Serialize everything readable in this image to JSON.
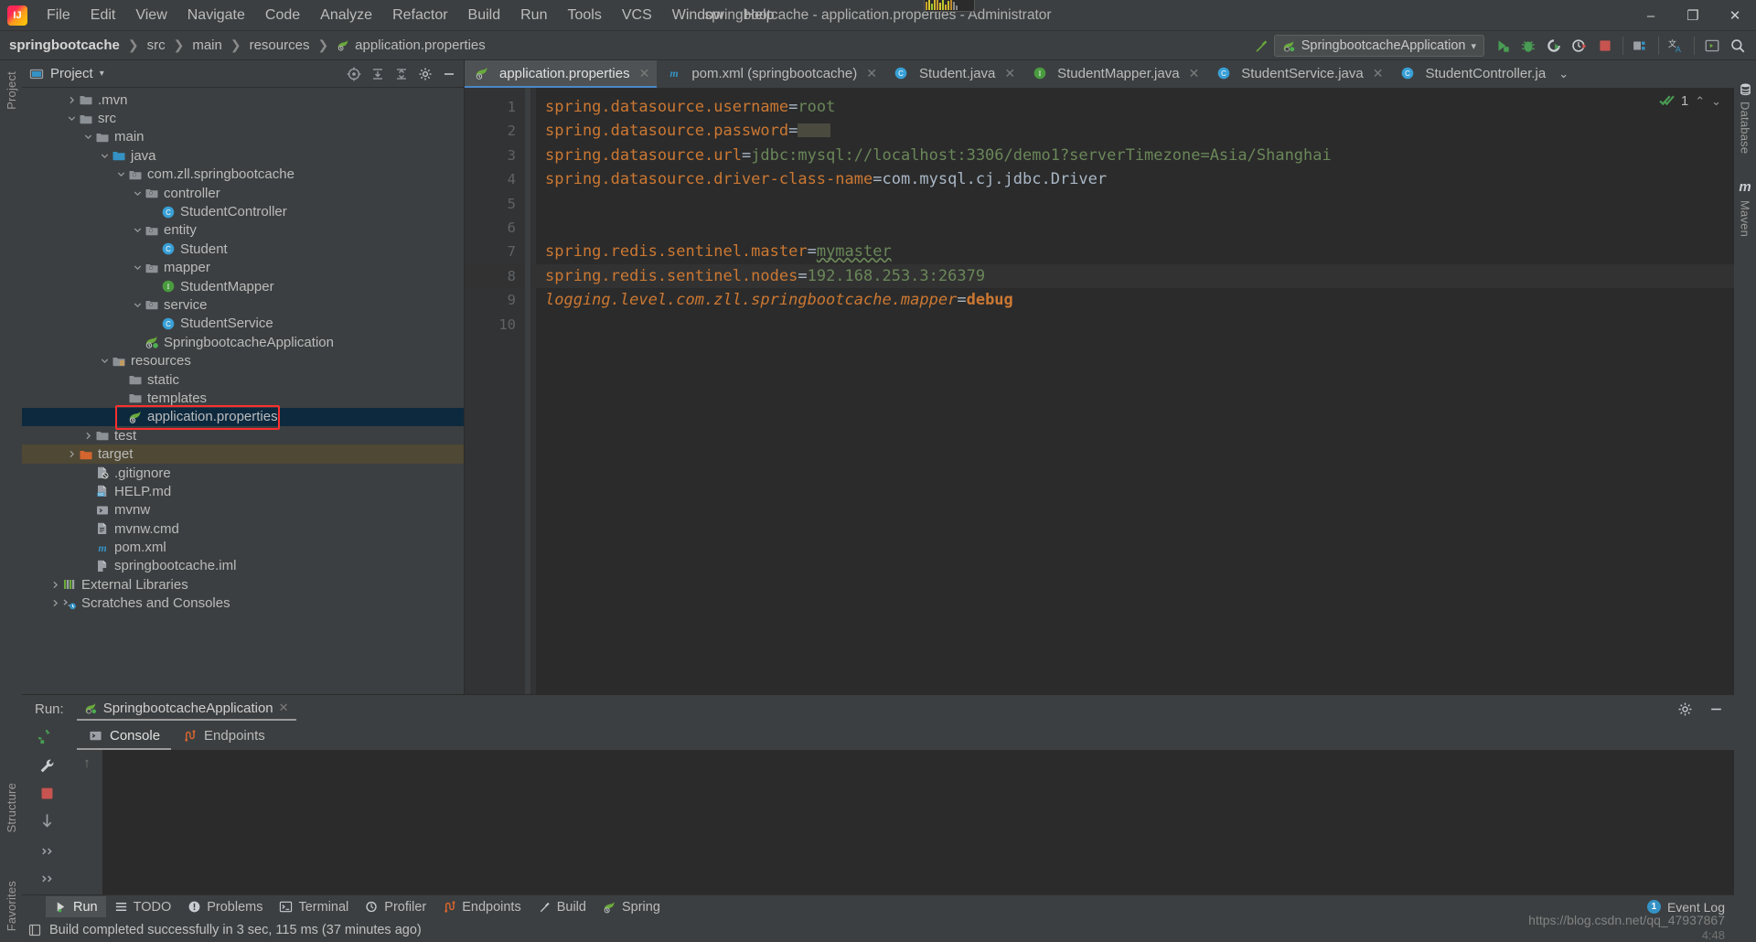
{
  "window": {
    "title": "springbootcache - application.properties - Administrator",
    "minimize": "–",
    "maximize": "❐",
    "close": "✕"
  },
  "menu": [
    {
      "label": "File"
    },
    {
      "label": "Edit"
    },
    {
      "label": "View"
    },
    {
      "label": "Navigate"
    },
    {
      "label": "Code"
    },
    {
      "label": "Analyze"
    },
    {
      "label": "Refactor"
    },
    {
      "label": "Build"
    },
    {
      "label": "Run"
    },
    {
      "label": "Tools"
    },
    {
      "label": "VCS"
    },
    {
      "label": "Window"
    },
    {
      "label": "Help"
    }
  ],
  "breadcrumb": {
    "items": [
      {
        "label": "springbootcache",
        "icon": "none"
      },
      {
        "label": "src",
        "icon": "none"
      },
      {
        "label": "main",
        "icon": "none"
      },
      {
        "label": "resources",
        "icon": "none"
      },
      {
        "label": "application.properties",
        "icon": "spring-leaf-icon"
      }
    ],
    "separator": "❯"
  },
  "toolbar": {
    "run_config": "SpringbootcacheApplication",
    "run_config_caret": "▾",
    "buttons": [
      {
        "name": "build-hammer-icon"
      },
      {
        "name": "run-icon"
      },
      {
        "name": "debug-icon"
      },
      {
        "name": "run-coverage-icon"
      },
      {
        "name": "profiler-icon"
      },
      {
        "name": "stop-icon"
      },
      {
        "name": "project-structure-icon"
      },
      {
        "name": "translate-icon"
      },
      {
        "name": "restclient-icon"
      },
      {
        "name": "search-everywhere-icon"
      }
    ]
  },
  "project_panel": {
    "title": "Project",
    "caret": "▾",
    "header_buttons": [
      "target-icon",
      "expand-all-icon",
      "collapse-all-icon",
      "settings-gear-icon",
      "hide-icon"
    ],
    "tree": [
      {
        "label": ".mvn",
        "indent": 2,
        "arrow": "right",
        "icon": "folder-icon",
        "state": "normal"
      },
      {
        "label": "src",
        "indent": 2,
        "arrow": "down",
        "icon": "folder-icon",
        "state": "normal"
      },
      {
        "label": "main",
        "indent": 3,
        "arrow": "down",
        "icon": "folder-icon",
        "state": "normal"
      },
      {
        "label": "java",
        "indent": 4,
        "arrow": "down",
        "icon": "source-folder-icon",
        "state": "normal"
      },
      {
        "label": "com.zll.springbootcache",
        "indent": 5,
        "arrow": "down",
        "icon": "package-icon",
        "state": "normal"
      },
      {
        "label": "controller",
        "indent": 6,
        "arrow": "down",
        "icon": "package-icon",
        "state": "normal"
      },
      {
        "label": "StudentController",
        "indent": 7,
        "arrow": "none",
        "icon": "java-class-icon",
        "state": "normal"
      },
      {
        "label": "entity",
        "indent": 6,
        "arrow": "down",
        "icon": "package-icon",
        "state": "normal"
      },
      {
        "label": "Student",
        "indent": 7,
        "arrow": "none",
        "icon": "java-class-icon",
        "state": "normal"
      },
      {
        "label": "mapper",
        "indent": 6,
        "arrow": "down",
        "icon": "package-icon",
        "state": "normal"
      },
      {
        "label": "StudentMapper",
        "indent": 7,
        "arrow": "none",
        "icon": "java-interface-icon",
        "state": "normal"
      },
      {
        "label": "service",
        "indent": 6,
        "arrow": "down",
        "icon": "package-icon",
        "state": "normal"
      },
      {
        "label": "StudentService",
        "indent": 7,
        "arrow": "none",
        "icon": "java-class-icon",
        "state": "normal"
      },
      {
        "label": "SpringbootcacheApplication",
        "indent": 6,
        "arrow": "none",
        "icon": "spring-boot-run-icon",
        "state": "normal"
      },
      {
        "label": "resources",
        "indent": 4,
        "arrow": "down",
        "icon": "resources-folder-icon",
        "state": "normal"
      },
      {
        "label": "static",
        "indent": 5,
        "arrow": "none",
        "icon": "folder-icon",
        "state": "normal"
      },
      {
        "label": "templates",
        "indent": 5,
        "arrow": "none",
        "icon": "folder-icon",
        "state": "normal"
      },
      {
        "label": "application.properties",
        "indent": 5,
        "arrow": "none",
        "icon": "spring-leaf-icon",
        "state": "selected"
      },
      {
        "label": "test",
        "indent": 3,
        "arrow": "right",
        "icon": "folder-icon",
        "state": "normal"
      },
      {
        "label": "target",
        "indent": 2,
        "arrow": "right",
        "icon": "excluded-folder-icon",
        "state": "target"
      },
      {
        "label": ".gitignore",
        "indent": 3,
        "arrow": "none",
        "icon": "gitignore-file-icon",
        "state": "normal"
      },
      {
        "label": "HELP.md",
        "indent": 3,
        "arrow": "none",
        "icon": "markdown-file-icon",
        "state": "normal"
      },
      {
        "label": "mvnw",
        "indent": 3,
        "arrow": "none",
        "icon": "shell-script-icon",
        "state": "normal"
      },
      {
        "label": "mvnw.cmd",
        "indent": 3,
        "arrow": "none",
        "icon": "text-file-icon",
        "state": "normal"
      },
      {
        "label": "pom.xml",
        "indent": 3,
        "arrow": "none",
        "icon": "maven-file-icon",
        "state": "normal"
      },
      {
        "label": "springbootcache.iml",
        "indent": 3,
        "arrow": "none",
        "icon": "iml-file-icon",
        "state": "normal"
      },
      {
        "label": "External Libraries",
        "indent": 1,
        "arrow": "right",
        "icon": "libraries-icon",
        "state": "normal"
      },
      {
        "label": "Scratches and Consoles",
        "indent": 1,
        "arrow": "right",
        "icon": "scratches-icon",
        "state": "normal"
      }
    ]
  },
  "editor": {
    "tabs": [
      {
        "label": "application.properties",
        "icon": "spring-leaf-icon",
        "active": true,
        "close": "✕"
      },
      {
        "label": "pom.xml (springbootcache)",
        "icon": "maven-file-icon",
        "active": false,
        "close": "✕"
      },
      {
        "label": "Student.java",
        "icon": "java-class-icon",
        "active": false,
        "close": "✕"
      },
      {
        "label": "StudentMapper.java",
        "icon": "java-interface-icon",
        "active": false,
        "close": "✕"
      },
      {
        "label": "StudentService.java",
        "icon": "java-class-icon",
        "active": false,
        "close": "✕"
      },
      {
        "label": "StudentController.ja",
        "icon": "java-class-icon",
        "active": false,
        "close": ""
      }
    ],
    "tabs_overflow": "⌄",
    "line_numbers": [
      "1",
      "2",
      "3",
      "4",
      "5",
      "6",
      "7",
      "8",
      "9",
      "10"
    ],
    "highlighted_line": 8,
    "lines": [
      {
        "n": 1,
        "key": "spring.datasource.username",
        "eq": "=",
        "value": "root",
        "value_class": "v",
        "key_class": "k",
        "masked": false
      },
      {
        "n": 2,
        "key": "spring.datasource.password",
        "eq": "=",
        "value": "",
        "value_class": "v",
        "key_class": "k",
        "masked": true
      },
      {
        "n": 3,
        "key": "spring.datasource.url",
        "eq": "=",
        "value": "jdbc:mysql://localhost:3306/demo1?serverTimezone=Asia/Shanghai",
        "value_class": "v",
        "key_class": "k",
        "masked": false
      },
      {
        "n": 4,
        "key": "spring.datasource.driver-class-name",
        "eq": "=",
        "value": "com.mysql.cj.jdbc.Driver",
        "value_class": "vd",
        "key_class": "k",
        "masked": false
      },
      {
        "n": 5,
        "key": "",
        "eq": "",
        "value": "",
        "value_class": "v",
        "key_class": "k",
        "masked": false
      },
      {
        "n": 6,
        "key": "",
        "eq": "",
        "value": "",
        "value_class": "v",
        "key_class": "k",
        "masked": false
      },
      {
        "n": 7,
        "key": "spring.redis.sentinel.master",
        "eq": "=",
        "value": "mymaster",
        "value_class": "v squiggle",
        "key_class": "k",
        "masked": false
      },
      {
        "n": 8,
        "key": "spring.redis.sentinel.nodes",
        "eq": "=",
        "value": "192.168.253.3:26379",
        "value_class": "v",
        "key_class": "k",
        "masked": false
      },
      {
        "n": 9,
        "key": "logging.level.com.zll.springbootcache.mapper",
        "eq": "=",
        "value": "debug",
        "value_class": "kw",
        "key_class": "ki",
        "masked": false
      },
      {
        "n": 10,
        "key": "",
        "eq": "",
        "value": "",
        "value_class": "v",
        "key_class": "k",
        "masked": false
      }
    ],
    "inspection": {
      "count": "1",
      "up": "⌃",
      "down": "⌄",
      "icon": "inspection-ok-icon"
    }
  },
  "run_window": {
    "label": "Run:",
    "tab": "SpringbootcacheApplication",
    "tab_icon": "spring-boot-run-icon",
    "tab_close": "✕",
    "settings_icon": "settings-gear-icon",
    "hide_icon": "hide-icon",
    "sidebar_buttons": [
      "rerun-icon",
      "wrench-icon",
      "stop-icon",
      "down-arrow-icon",
      "expand-icon",
      "more-icon"
    ],
    "subtabs": [
      {
        "label": "Console",
        "icon": "console-icon",
        "active": true
      },
      {
        "label": "Endpoints",
        "icon": "endpoints-icon",
        "active": false
      }
    ],
    "scroll_up": "↑"
  },
  "tool_window_bar": [
    {
      "label": "Run",
      "icon": "run-icon",
      "active": true
    },
    {
      "label": "TODO",
      "icon": "todo-icon",
      "active": false
    },
    {
      "label": "Problems",
      "icon": "problems-icon",
      "active": false
    },
    {
      "label": "Terminal",
      "icon": "terminal-icon",
      "active": false
    },
    {
      "label": "Profiler",
      "icon": "profiler-icon",
      "active": false
    },
    {
      "label": "Endpoints",
      "icon": "endpoints-icon",
      "active": false
    },
    {
      "label": "Build",
      "icon": "build-icon",
      "active": false
    },
    {
      "label": "Spring",
      "icon": "spring-leaf-icon",
      "active": false
    }
  ],
  "event_log": {
    "count": "1",
    "label": "Event Log"
  },
  "status_bar": {
    "message": "Build completed successfully in 3 sec, 115 ms (37 minutes ago)",
    "icon": "build-status-icon"
  },
  "left_strip": [
    {
      "label": "Project"
    },
    {
      "label": "Structure"
    },
    {
      "label": "Favorites"
    }
  ],
  "right_strip": [
    {
      "label": "Database",
      "icon": "database-icon"
    },
    {
      "label": "Maven",
      "icon": "maven-file-icon"
    }
  ],
  "watermark": {
    "url": "https://blog.csdn.net/qq_47937867",
    "extra": "4:48"
  },
  "colors": {
    "accent_blue": "#4a88c7",
    "selection": "#0d293e",
    "target_row": "#4e4834",
    "red_highlight": "#fb2f2f",
    "key_orange": "#cc7832",
    "value_green": "#6a8759",
    "value_gray": "#a9b7c6",
    "panel_bg": "#3c3f41",
    "editor_bg": "#2b2b2b"
  }
}
